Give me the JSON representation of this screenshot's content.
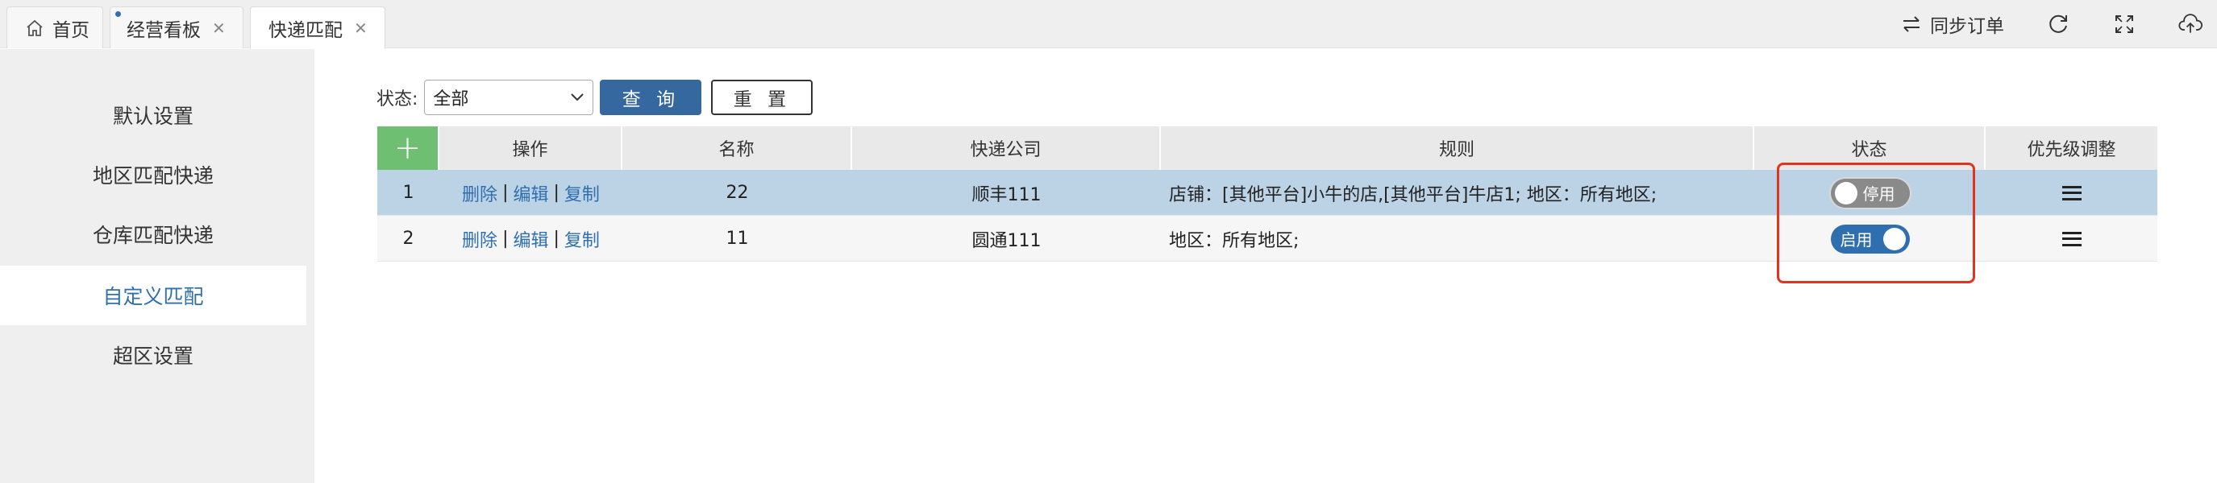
{
  "tabs": [
    {
      "label": "首页",
      "icon": "home-icon"
    },
    {
      "label": "经营看板",
      "closable": true,
      "modified": true
    },
    {
      "label": "快递匹配",
      "closable": true,
      "active": true
    }
  ],
  "close_glyph": "✕",
  "top_actions": {
    "sync_label": "同步订单",
    "icons": [
      "refresh-icon",
      "fullscreen-icon",
      "cloud-upload-icon"
    ]
  },
  "sidebar": {
    "items": [
      {
        "label": "默认设置"
      },
      {
        "label": "地区匹配快递"
      },
      {
        "label": "仓库匹配快递"
      },
      {
        "label": "自定义匹配",
        "active": true
      },
      {
        "label": "超区设置"
      }
    ]
  },
  "filter": {
    "status_label": "状态:",
    "status_value": "全部",
    "query_label": "查 询",
    "reset_label": "重 置"
  },
  "table": {
    "add_glyph": "+",
    "headers": [
      "操作",
      "名称",
      "快递公司",
      "规则",
      "状态",
      "优先级调整"
    ],
    "ops": {
      "delete": "删除",
      "edit": "编辑",
      "copy": "复制",
      "sep": "|"
    },
    "rows": [
      {
        "index": "1",
        "name": "22",
        "company": "顺丰111",
        "rule": "店铺：[其他平台]小牛的店,[其他平台]牛店1; 地区：所有地区;",
        "status": "停用",
        "enabled": false
      },
      {
        "index": "2",
        "name": "11",
        "company": "圆通111",
        "rule": "地区：所有地区;",
        "status": "启用",
        "enabled": true
      }
    ]
  },
  "colors": {
    "accent": "#2f6fb0",
    "add_button": "#6fbf73",
    "selected_row": "#bcd2e5",
    "highlight_box": "#e0341f"
  }
}
